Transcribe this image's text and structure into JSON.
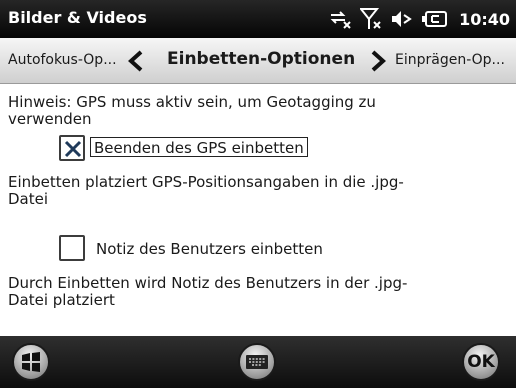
{
  "status_bar": {
    "title": "Bilder & Videos",
    "time": "10:40",
    "icons": [
      "connectivity-off-icon",
      "signal-off-icon",
      "volume-icon",
      "battery-icon"
    ]
  },
  "tab_header": {
    "prev_label": "Autofokus-Op...",
    "current_label": "Einbetten-Optionen",
    "next_label": "Einprägen-Op..."
  },
  "content": {
    "hint": "Hinweis: GPS muss aktiv sein, um Geotagging zu verwenden",
    "gps_checkbox": {
      "label": "Beenden des GPS einbetten",
      "checked": true
    },
    "gps_description": "Einbetten platziert GPS-Positionsangaben in die .jpg-Datei",
    "note_checkbox": {
      "label": "Notiz des Benutzers einbetten",
      "checked": false
    },
    "note_description": "Durch Einbetten wird Notiz des Benutzers in der .jpg-Datei platziert"
  },
  "bottom_bar": {
    "ok_label": "OK",
    "icons": [
      "windows-start-icon",
      "keyboard-icon"
    ]
  }
}
